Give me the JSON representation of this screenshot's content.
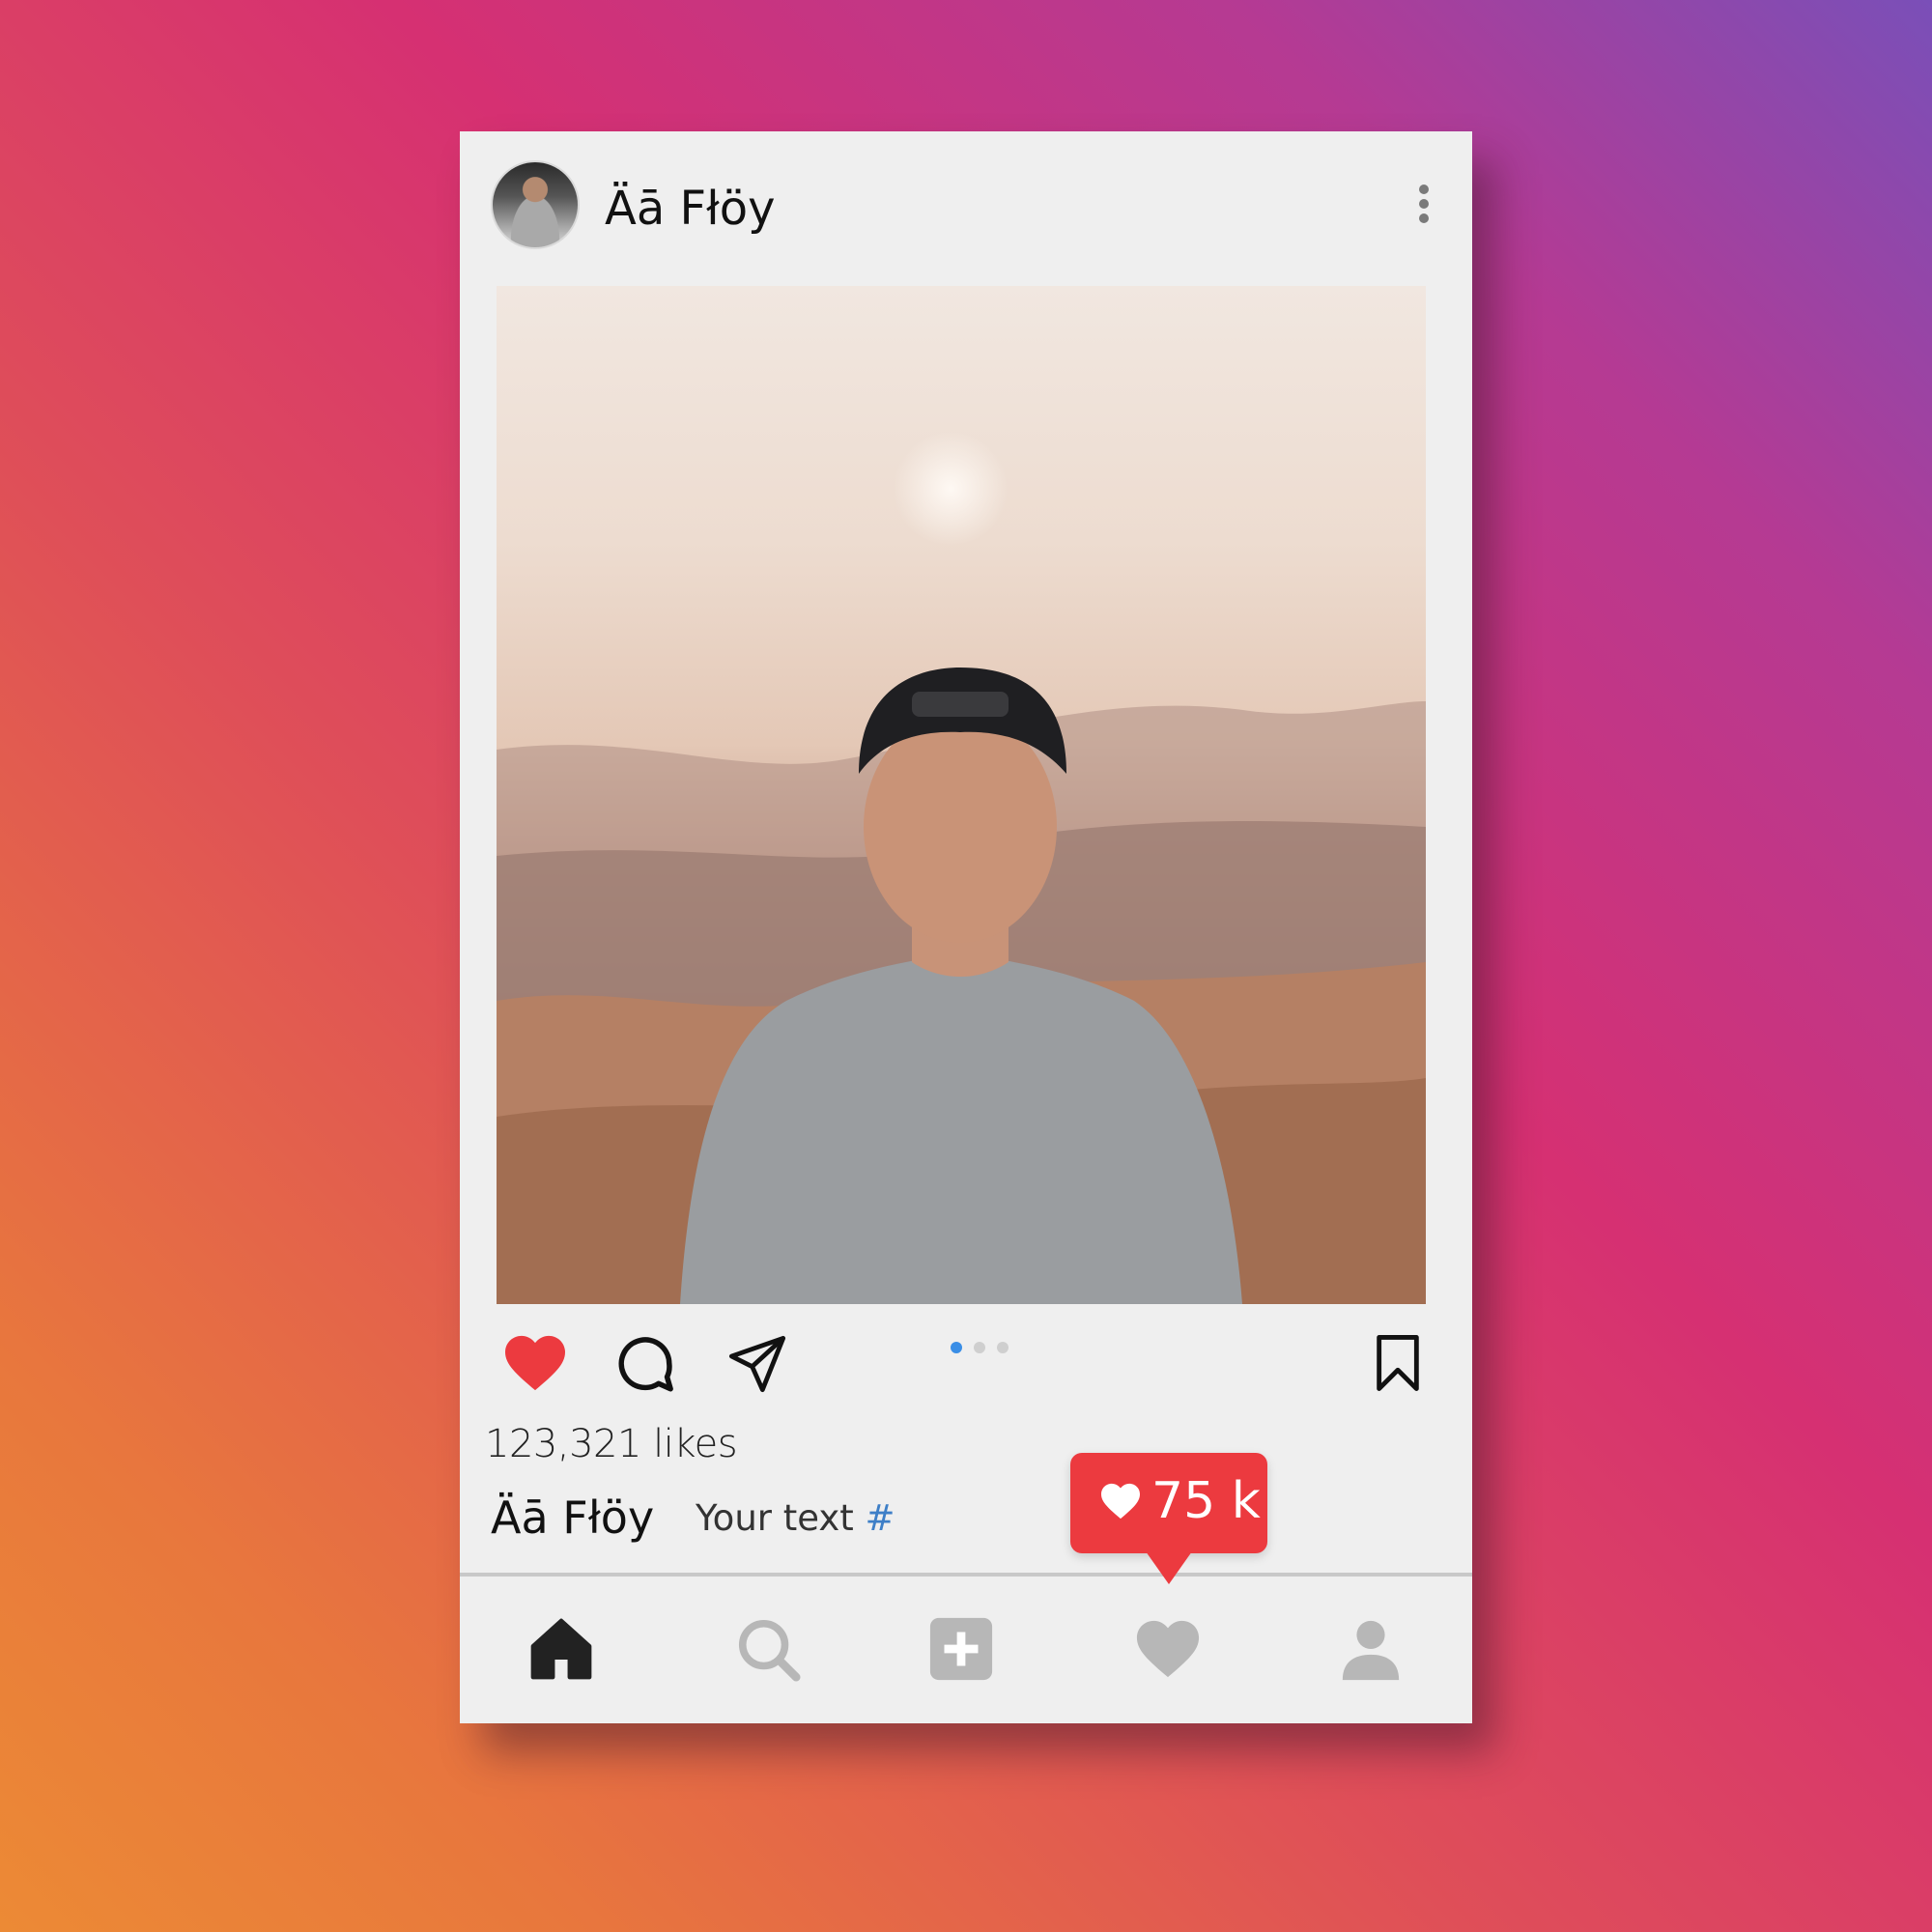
{
  "post": {
    "username": "Äā Fłöy",
    "likes_text": "123,321 likes",
    "caption_user": "Äā Fłöy",
    "caption_text": "Your text ",
    "caption_hashtags": "#"
  },
  "carousel": {
    "count": 3,
    "active_index": 0
  },
  "notification": {
    "count": "75 k"
  },
  "colors": {
    "like_red": "#ec3a3f",
    "carousel_active": "#3a8ee6"
  },
  "icons": {
    "more": "vertical-dots-icon",
    "like": "heart-filled-icon",
    "comment": "comment-bubble-icon",
    "share": "paper-plane-icon",
    "save": "bookmark-icon",
    "nav": [
      "home-icon",
      "search-icon",
      "add-post-icon",
      "activity-heart-icon",
      "profile-icon"
    ]
  }
}
